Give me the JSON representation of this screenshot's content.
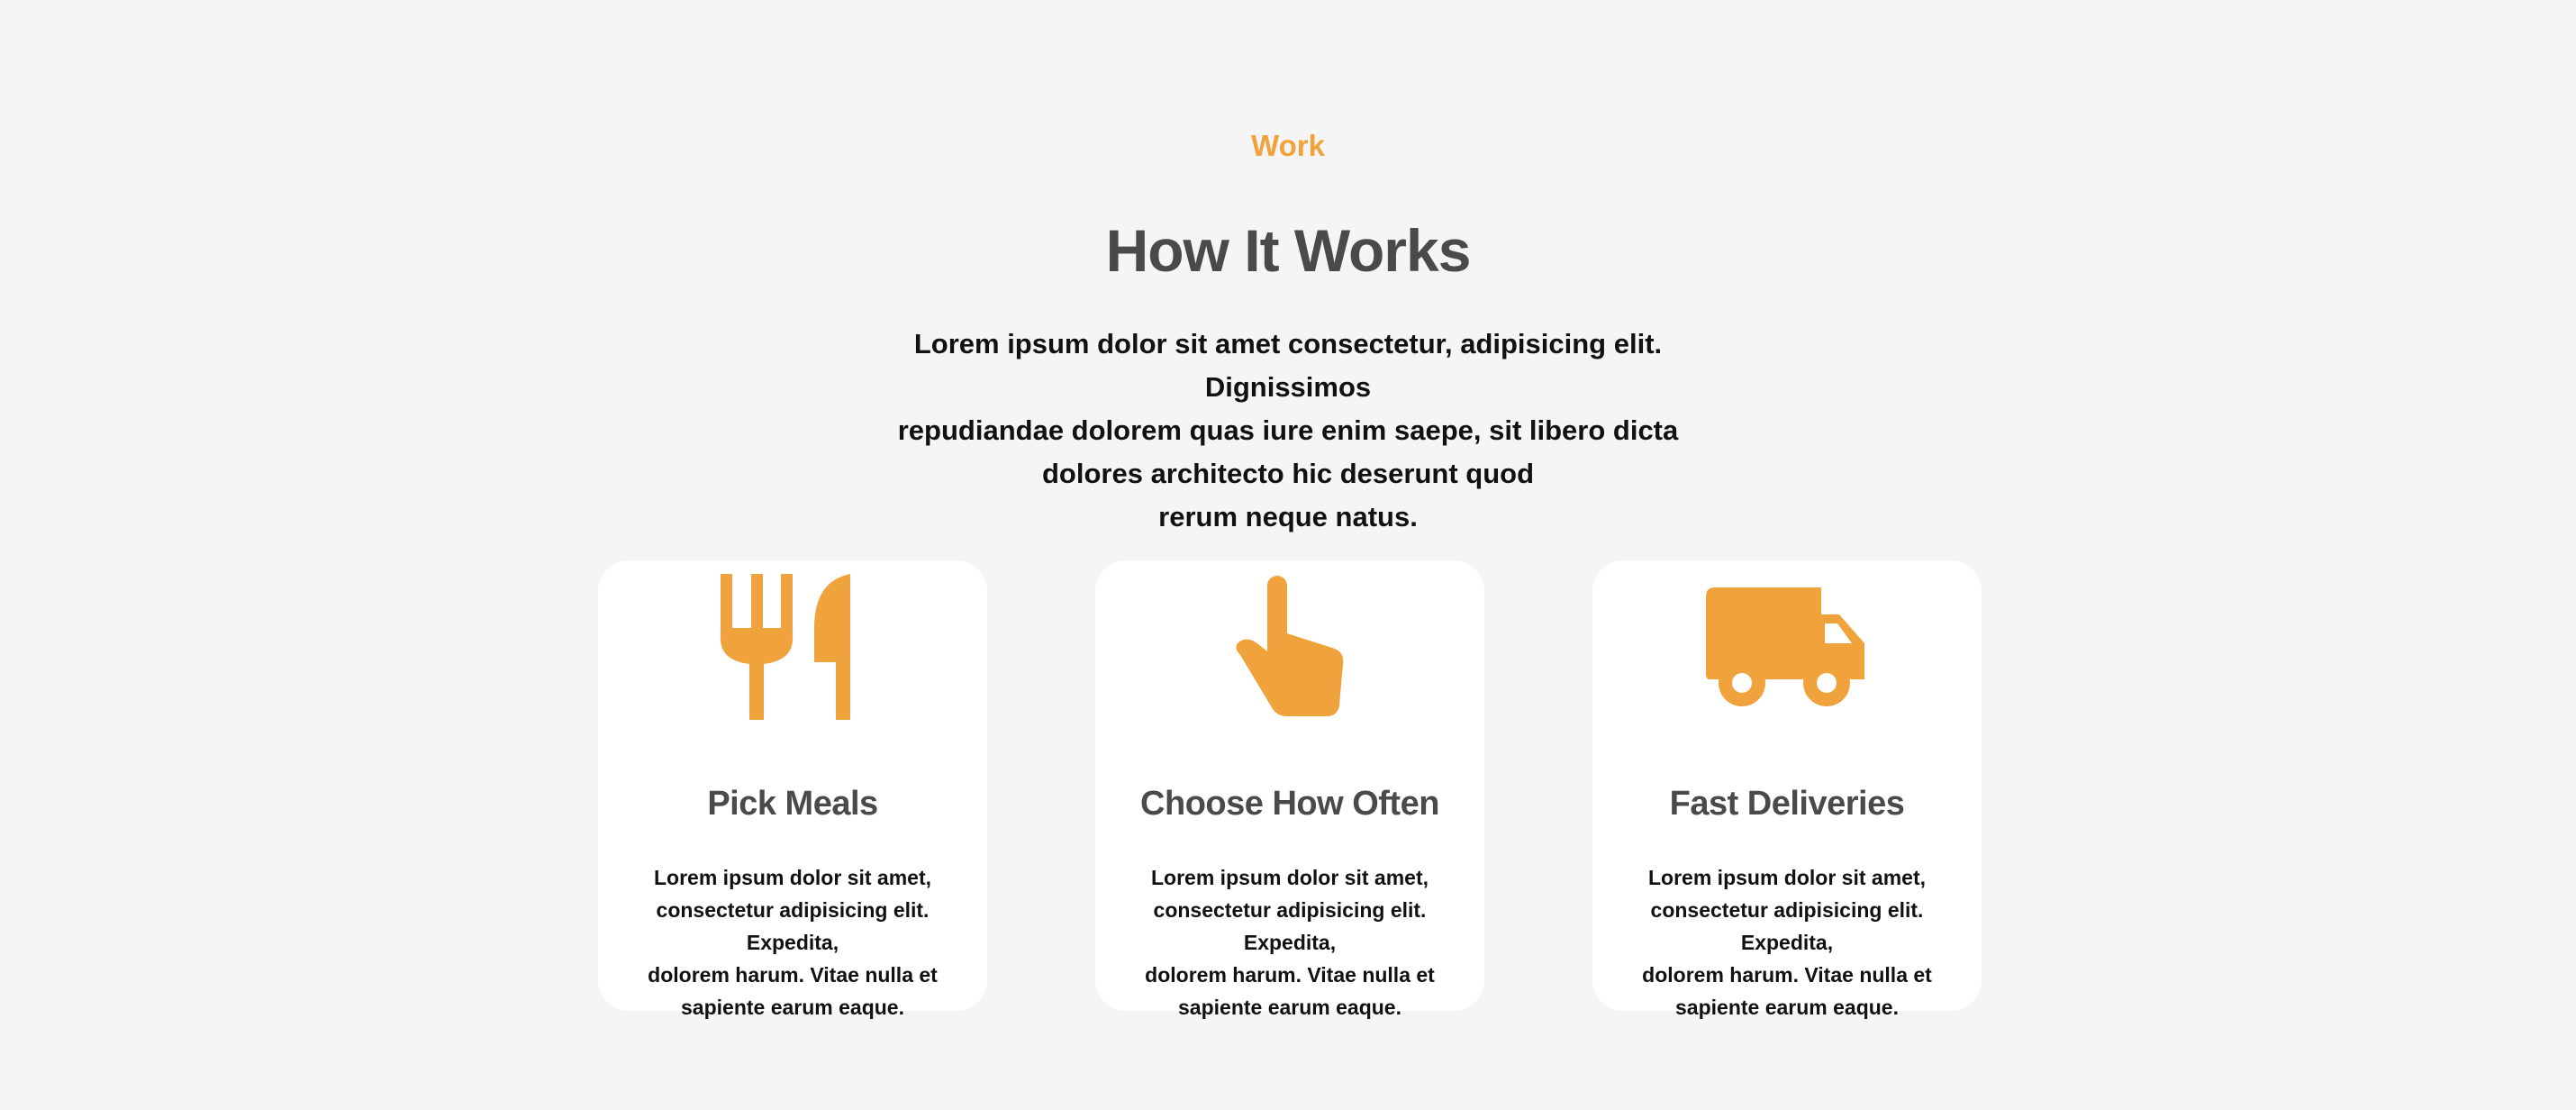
{
  "section": {
    "eyebrow": "Work",
    "title": "How It Works",
    "intro_lines": [
      "Lorem ipsum dolor sit amet consectetur, adipisicing elit. Dignissimos",
      "repudiandae dolorem quas iure enim saepe, sit libero dicta",
      "dolores architecto hic deserunt quod",
      "rerum neque natus."
    ]
  },
  "theme": {
    "accent": "#f0a23d",
    "heading": "#4a4a4a",
    "body_text": "#111111",
    "background": "#f5f5f5",
    "card_background": "#ffffff"
  },
  "cards": [
    {
      "icon": "fork-knife-icon",
      "title": "Pick Meals",
      "text_lines": [
        "Lorem ipsum dolor sit amet,",
        "consectetur adipisicing elit. Expedita,",
        "dolorem harum. Vitae nulla et",
        "sapiente earum eaque."
      ]
    },
    {
      "icon": "pointing-hand-icon",
      "title": "Choose How Often",
      "text_lines": [
        "Lorem ipsum dolor sit amet,",
        "consectetur adipisicing elit. Expedita,",
        "dolorem harum. Vitae nulla et",
        "sapiente earum eaque."
      ]
    },
    {
      "icon": "delivery-truck-icon",
      "title": "Fast Deliveries",
      "text_lines": [
        "Lorem ipsum dolor sit amet,",
        "consectetur adipisicing elit. Expedita,",
        "dolorem harum. Vitae nulla et",
        "sapiente earum eaque."
      ]
    }
  ]
}
